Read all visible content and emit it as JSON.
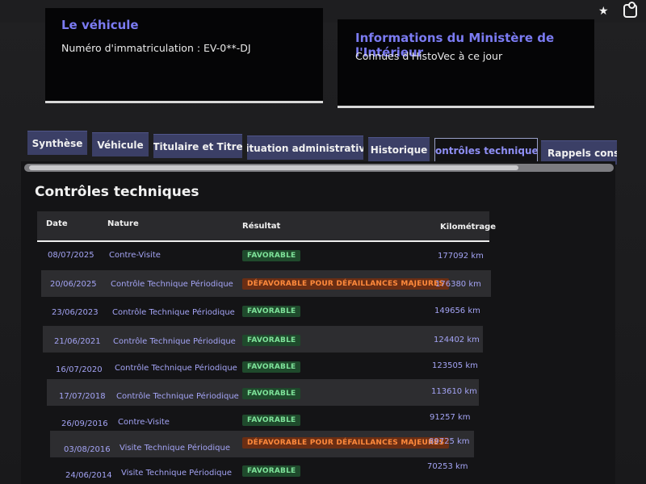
{
  "browser": {
    "star_icon": "star-icon",
    "extension_icon": "puzzle-icon"
  },
  "vehicle_card": {
    "title": "Le véhicule",
    "plate": "Numéro d'immatriculation : EV-0**-DJ"
  },
  "ministry_card": {
    "title": "Informations du Ministère de l'Intérieur",
    "subtitle": "Connues d'HistoVec à ce jour"
  },
  "tabs": [
    {
      "label": "Synthèse"
    },
    {
      "label": "Véhicule"
    },
    {
      "label": "Titulaire et Titre"
    },
    {
      "label": "Situation administrative"
    },
    {
      "label": "Historique"
    },
    {
      "label": "Contrôles techniques",
      "active": true
    },
    {
      "label": "Rappels constructeur"
    }
  ],
  "section": {
    "title": "Contrôles techniques"
  },
  "table": {
    "headers": {
      "date": "Date",
      "nature": "Nature",
      "result": "Résultat",
      "km": "Kilométrage"
    },
    "rows": [
      {
        "date": "08/07/2025",
        "nature": "Contre-Visite",
        "result": "FAVORABLE",
        "status": "ok",
        "km": "177092 km"
      },
      {
        "date": "20/06/2025",
        "nature": "Contrôle Technique Périodique",
        "result": "DÉFAVORABLE POUR DÉFAILLANCES MAJEURES",
        "status": "ko",
        "km": "176380 km"
      },
      {
        "date": "23/06/2023",
        "nature": "Contrôle Technique Périodique",
        "result": "FAVORABLE",
        "status": "ok",
        "km": "149656 km"
      },
      {
        "date": "21/06/2021",
        "nature": "Contrôle Technique Périodique",
        "result": "FAVORABLE",
        "status": "ok",
        "km": "124402 km"
      },
      {
        "date": "16/07/2020",
        "nature": "Contrôle Technique Périodique",
        "result": "FAVORABLE",
        "status": "ok",
        "km": "123505 km"
      },
      {
        "date": "17/07/2018",
        "nature": "Contrôle Technique Périodique",
        "result": "FAVORABLE",
        "status": "ok",
        "km": "113610 km"
      },
      {
        "date": "26/09/2016",
        "nature": "Contre-Visite",
        "result": "FAVORABLE",
        "status": "ok",
        "km": "91257 km"
      },
      {
        "date": "03/08/2016",
        "nature": "Visite Technique Périodique",
        "result": "DÉFAVORABLE POUR DÉFAILLANCES MAJEURES",
        "status": "ko",
        "km": "89725 km"
      },
      {
        "date": "24/06/2014",
        "nature": "Visite Technique Périodique",
        "result": "FAVORABLE",
        "status": "ok",
        "km": "70253 km"
      }
    ]
  },
  "colors": {
    "accent": "#7b7bf2",
    "tab_bg": "#3b3f66",
    "favorable": "#7ee39a",
    "defavorable": "#ff8a3c"
  }
}
